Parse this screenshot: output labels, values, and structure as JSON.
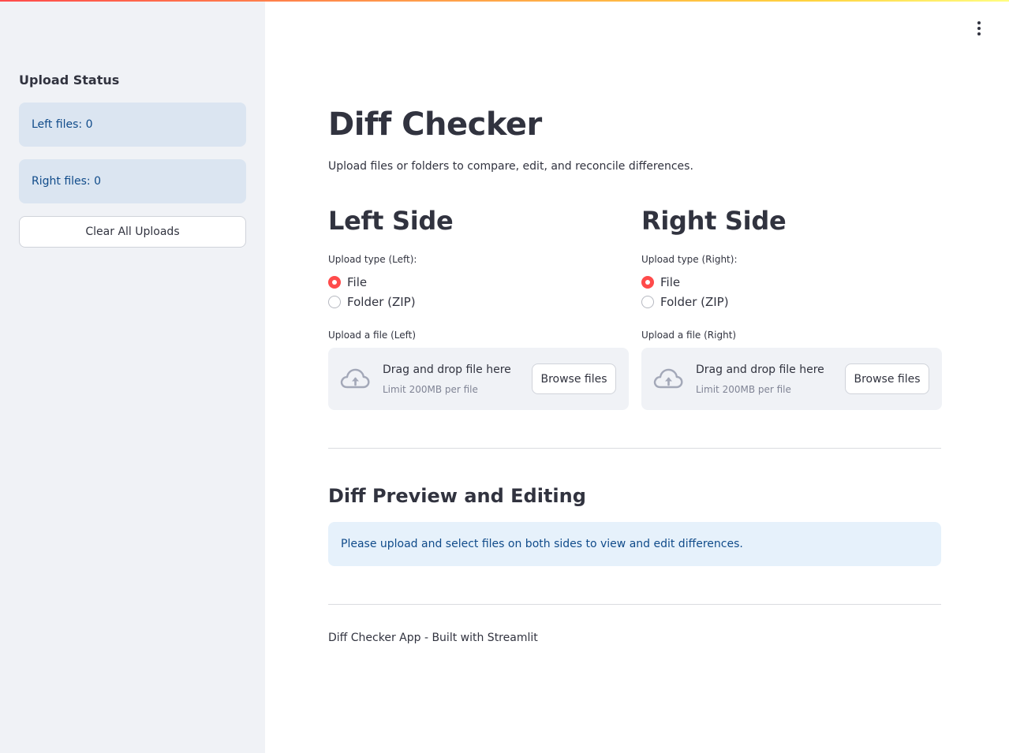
{
  "sidebar": {
    "title": "Upload Status",
    "left_files": "Left files: 0",
    "right_files": "Right files: 0",
    "clear_button": "Clear All Uploads"
  },
  "header": {
    "menu_icon": "kebab-menu-icon"
  },
  "main": {
    "title": "Diff Checker",
    "subtitle": "Upload files or folders to compare, edit, and reconcile differences.",
    "left": {
      "heading": "Left Side",
      "upload_type_label": "Upload type (Left):",
      "options": [
        "File",
        "Folder (ZIP)"
      ],
      "selected": "File",
      "upload_label": "Upload a file (Left)",
      "dropzone_text": "Drag and drop file here",
      "dropzone_limit": "Limit 200MB per file",
      "browse_label": "Browse files"
    },
    "right": {
      "heading": "Right Side",
      "upload_type_label": "Upload type (Right):",
      "options": [
        "File",
        "Folder (ZIP)"
      ],
      "selected": "File",
      "upload_label": "Upload a file (Right)",
      "dropzone_text": "Drag and drop file here",
      "dropzone_limit": "Limit 200MB per file",
      "browse_label": "Browse files"
    },
    "diff_section_title": "Diff Preview and Editing",
    "diff_notice": "Please upload and select files on both sides to view and edit differences.",
    "footer": "Diff Checker App - Built with Streamlit"
  },
  "colors": {
    "accent": "#ff4b4b",
    "sidebar_bg": "#f0f2f6",
    "info_bg": "#dbe5f1",
    "info_text": "#104b8a"
  }
}
